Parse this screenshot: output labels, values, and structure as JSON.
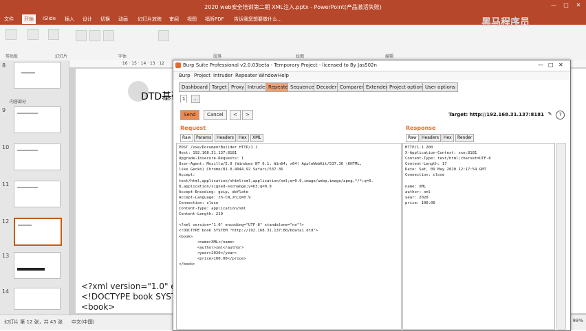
{
  "ppt": {
    "window_title": "2020 web安全培训第二期 XML注入.pptx - PowerPoint(产品激活失败)",
    "tabs": [
      "文件",
      "开始",
      "iSlide",
      "插入",
      "设计",
      "切换",
      "动画",
      "幻灯片放映",
      "审阅",
      "视图",
      "福昕PDF"
    ],
    "active_tab": "开始",
    "tell_me": "告诉我您想要做什么...",
    "ribbon_groups": [
      "剪贴板",
      "幻灯片",
      "字体",
      "段落",
      "绘图",
      "编辑"
    ],
    "ruler_text": "·16 · 15 · 14 · 13 · 12",
    "slide_numbers": [
      "8",
      "9",
      "10",
      "11",
      "12",
      "13",
      "14"
    ],
    "section_label": "内容部分",
    "slide_title": "DTD基础",
    "slide_code_lines": [
      "<?xml version=\"1.0\" en",
      "<!DOCTYPE book SYST",
      "<book>"
    ],
    "status": "幻灯片 第 12 张，共 45 张",
    "language": "中文(中国)",
    "zoom": "99%",
    "watermark": "黑马程序员"
  },
  "burp": {
    "title": "Burp Suite Professional v2.0.03beta - Temporary Project - licensed to By Jas502n",
    "menu": [
      "Burp",
      "Project",
      "Intruder",
      "Repeater",
      "Window",
      "Help"
    ],
    "tabs": [
      "Dashboard",
      "Target",
      "Proxy",
      "Intruder",
      "Repeater",
      "Sequencer",
      "Decoder",
      "Comparer",
      "Extender",
      "Project options",
      "User options"
    ],
    "active_tab": "Repeater",
    "sub_tabs": [
      "1",
      "..."
    ],
    "send_label": "Send",
    "cancel_label": "Cancel",
    "prev_label": "<",
    "next_label": ">",
    "target": "Target: http://192.168.31.137:8181",
    "request_title": "Request",
    "response_title": "Response",
    "request_tabs": [
      "Raw",
      "Params",
      "Headers",
      "Hex",
      "XML"
    ],
    "response_tabs": [
      "Raw",
      "Headers",
      "Hex",
      "Render"
    ],
    "request_body": "POST /xxe/DocumentBuilder HTTP/1.1\nHost: 192.168.31.137:8181\nUpgrade-Insecure-Requests: 1\nUser-Agent: Mozilla/5.0 (Windows NT 6.1; Win64; x64) AppleWebKit/537.36 (KHTML,\nlike Gecko) Chrome/81.0.4044.92 Safari/537.36\nAccept:\ntext/html,application/xhtml+xml,application/xml;q=0.9,image/webp,image/apng,*/*;q=0.\n8,application/signed-exchange;v=b3;q=0.9\nAccept-Encoding: gzip, deflate\nAccept-Language: zh-CN,zh;q=0.9\nConnection: close\nContent-Type: application/xml\nContent-Length: 219\n\n<?xml version=\"1.0\" encoding=\"UTF-8\" standalone=\"no\"?>\n<!DOCTYPE book SYSTEM \"http://192.168.31.137:80/bdata1.dtd\">\n<book>\n        <name>XML</name>\n        <author>xml</author>\n        <year>2020</year>\n        <price>100.00</price>\n</book>",
    "response_body": "HTTP/1.1 200\nX-Application-Context: xxe:8181\nContent-Type: text/html;charset=UTF-8\nContent-Length: 17\nDate: Sat, 09 May 2020 12:17:54 GMT\nConnection: close\n\nname: XML\nauthor: xml\nyear: 2020\nprice: 100.00"
  }
}
